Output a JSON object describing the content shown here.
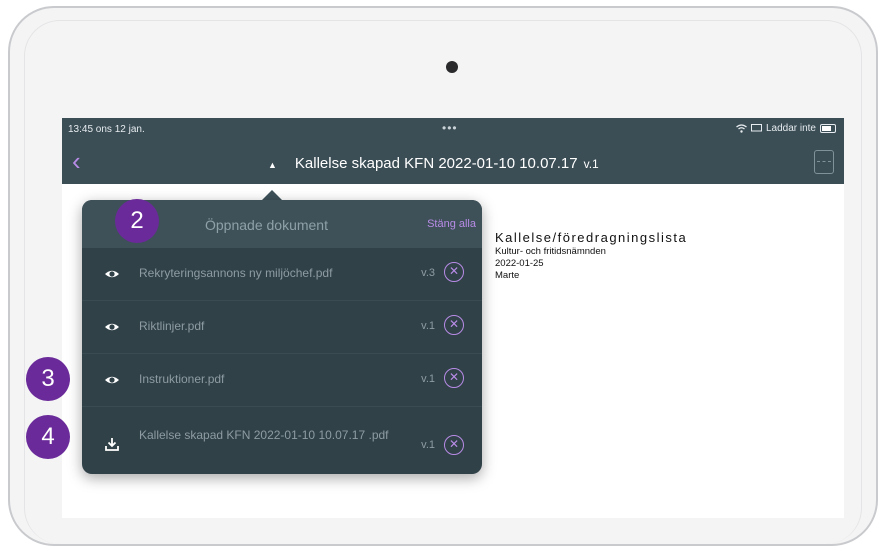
{
  "status_bar": {
    "time": "13:45  ons 12 jan.",
    "dots": "•••",
    "charging_text": "Laddar inte"
  },
  "nav": {
    "back_glyph": "‹",
    "caret_glyph": "▲",
    "title": "Kallelse skapad KFN 2022-01-10 10.07.17",
    "version": "v.1"
  },
  "document": {
    "title": "Kallelse/föredragningslista",
    "lines": [
      "Kultur- och fritidsnämnden",
      "2022-01-25",
      "Marte"
    ]
  },
  "popover": {
    "title": "Öppnade dokument",
    "close_all_label": "Stäng alla",
    "items": [
      {
        "icon": "eye-icon",
        "name": "Rekryteringsannons ny miljöchef.pdf",
        "version": "v.3"
      },
      {
        "icon": "eye-icon",
        "name": "Riktlinjer.pdf",
        "version": "v.1"
      },
      {
        "icon": "eye-icon",
        "name": "Instruktioner.pdf",
        "version": "v.1"
      },
      {
        "icon": "download-icon",
        "name": "Kallelse skapad KFN 2022-01-10 10.07.17 .pdf",
        "version": "v.1"
      }
    ]
  },
  "callouts": [
    "2",
    "3",
    "4"
  ],
  "colors": {
    "accent": "#b88be6",
    "bar": "#3b4d55",
    "popover": "#304148",
    "callout": "#6a2a99"
  }
}
